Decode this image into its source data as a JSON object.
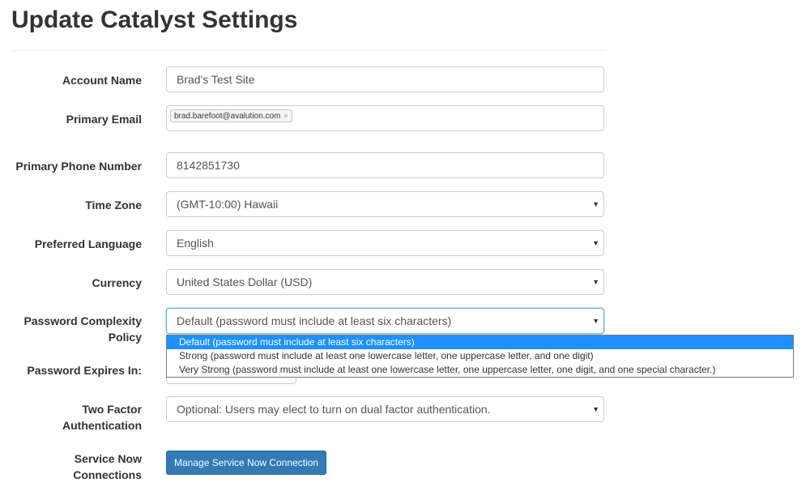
{
  "page": {
    "title": "Update Catalyst Settings"
  },
  "fields": {
    "account_name": {
      "label": "Account Name",
      "value": "Brad's Test Site"
    },
    "primary_email": {
      "label": "Primary Email",
      "tag": "brad.barefoot@avalution.com",
      "tag_remove": "×"
    },
    "primary_phone": {
      "label": "Primary Phone Number",
      "value": "8142851730"
    },
    "time_zone": {
      "label": "Time Zone",
      "value": "(GMT-10:00) Hawaii"
    },
    "preferred_language": {
      "label": "Preferred Language",
      "value": "English"
    },
    "currency": {
      "label": "Currency",
      "value": "United States Dollar (USD)"
    },
    "password_policy": {
      "label_line1": "Password Complexity",
      "label_line2": "Policy",
      "value": "Default (password must include at least six characters)",
      "options": [
        "Default (password must include at least six characters)",
        "Strong (password must include at least one lowercase letter, one uppercase letter, and one digit)",
        "Very Strong (password must include at least one lowercase letter, one uppercase letter, one digit, and one special character.)"
      ],
      "selected_index": 0
    },
    "password_expires": {
      "label": "Password Expires In:"
    },
    "two_factor": {
      "label_line1": "Two Factor",
      "label_line2": "Authentication",
      "value": "Optional: Users may elect to turn on dual factor authentication."
    },
    "service_now": {
      "label_line1": "Service Now",
      "label_line2": "Connections",
      "button": "Manage Service Now Connection"
    }
  },
  "icons": {
    "select_caret": "caret-down-icon",
    "tag_remove": "close-icon"
  },
  "colors": {
    "primary_button": "#337ab7",
    "dropdown_highlight": "#1e90ff",
    "focus_border": "#66afe9"
  }
}
